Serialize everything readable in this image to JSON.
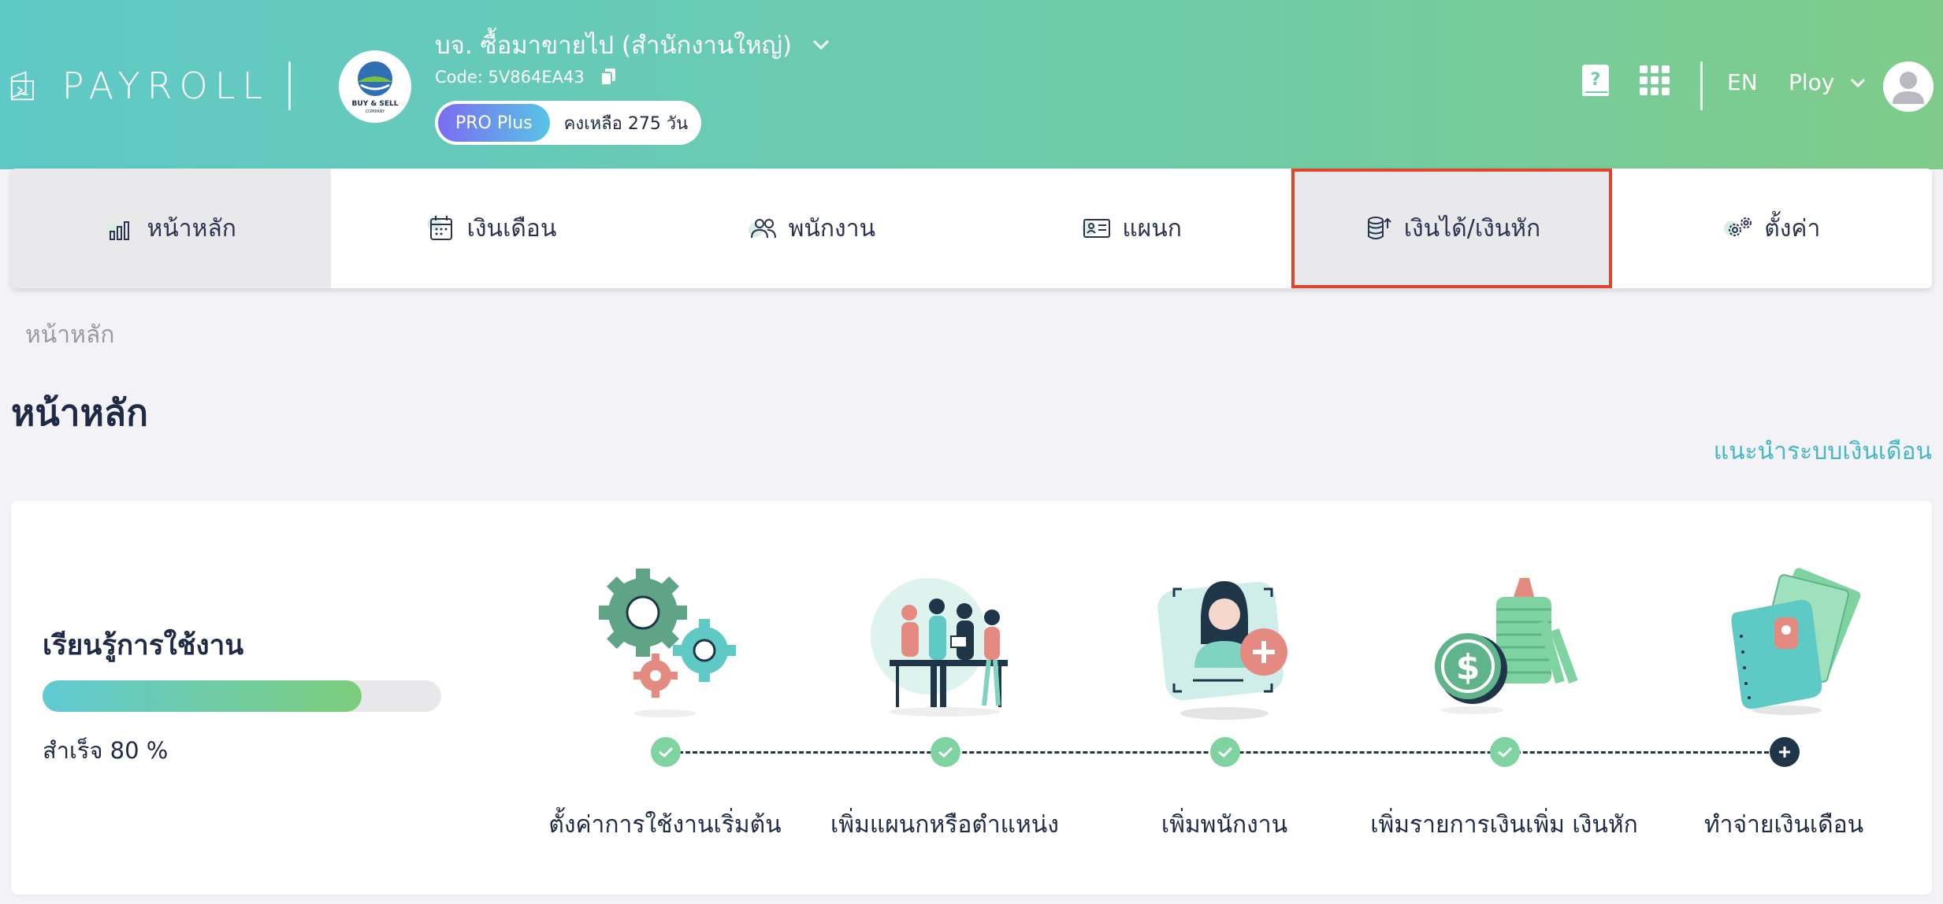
{
  "header": {
    "logo_text": "PAYROLL",
    "company_name": "บจ. ซื้อมาขายไป (สำนักงานใหญ่)",
    "company_code": "Code: 5V864EA43",
    "plan_badge": "PRO Plus",
    "plan_days": "คงเหลือ 275 วัน",
    "company_logo_text": "BUY & SELL",
    "company_logo_sub": "COMPANY",
    "language": "EN",
    "user_name": "Ploy"
  },
  "nav": {
    "tabs": [
      {
        "label": "หน้าหลัก",
        "icon": "bar-chart-icon",
        "state": "active"
      },
      {
        "label": "เงินเดือน",
        "icon": "calendar-icon",
        "state": "normal"
      },
      {
        "label": "พนักงาน",
        "icon": "users-icon",
        "state": "normal"
      },
      {
        "label": "แผนก",
        "icon": "id-card-icon",
        "state": "normal"
      },
      {
        "label": "เงินได้/เงินหัก",
        "icon": "coins-icon",
        "state": "highlighted"
      },
      {
        "label": "ตั้งค่า",
        "icon": "gears-icon",
        "state": "normal"
      }
    ]
  },
  "breadcrumb": "หน้าหลัก",
  "page_title": "หน้าหลัก",
  "guide_link": "แนะนำระบบเงินเดือน",
  "learning": {
    "title": "เรียนรู้การใช้งาน",
    "progress_percent": 80,
    "progress_text": "สำเร็จ 80 %",
    "steps": [
      {
        "label": "ตั้งค่าการใช้งานเริ่มต้น",
        "done": true,
        "icon": "gears-illustration"
      },
      {
        "label": "เพิ่มแผนกหรือตำแหน่ง",
        "done": true,
        "icon": "team-illustration"
      },
      {
        "label": "เพิ่มพนักงาน",
        "done": true,
        "icon": "add-employee-illustration"
      },
      {
        "label": "เพิ่มรายการเงินเพิ่ม เงินหัก",
        "done": true,
        "icon": "coins-illustration"
      },
      {
        "label": "ทำจ่ายเงินเดือน",
        "done": false,
        "icon": "wallet-illustration"
      }
    ]
  },
  "colors": {
    "header_gradient_start": "#5fc9c6",
    "header_gradient_end": "#7fcc8a",
    "highlight_border": "#e0442c",
    "link": "#46b8c4",
    "done_dot": "#7fd3a0",
    "todo_dot": "#1f3548"
  }
}
